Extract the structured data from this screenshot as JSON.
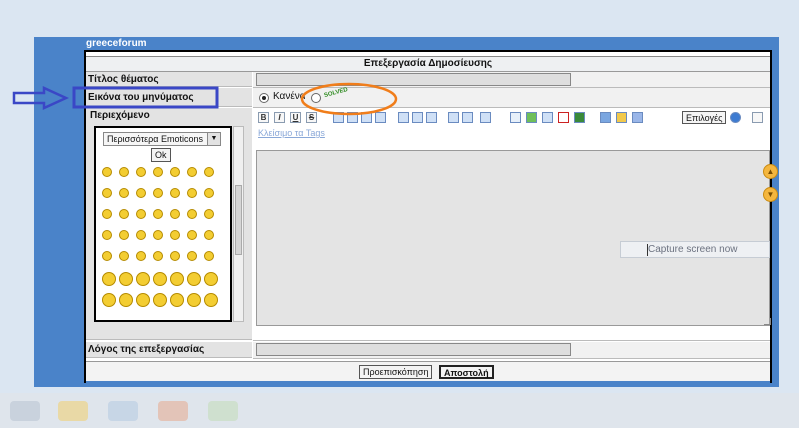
{
  "forum": {
    "title": "greeceforum"
  },
  "panel": {
    "heading": "Επεξεργασία Δημοσίευσης"
  },
  "labels": {
    "topic_title": "Τίτλος θέματος",
    "message_icon": "Εικόνα του μηνύματος",
    "content": "Περιεχόμενο",
    "edit_reason": "Λόγος της επεξεργασίας"
  },
  "icon_option": {
    "none_label": "Κανένα",
    "badge_text": "SOLVED"
  },
  "emoticons": {
    "dropdown_value": "Περισσότερα Emoticons",
    "ok_label": "Ok",
    "count": 49
  },
  "toolbar": {
    "bold": "B",
    "italic": "I",
    "underline": "U",
    "strike": "S",
    "options_label": "Επιλογές",
    "tag_link": "Κλείσιμο τα Tags"
  },
  "capture": {
    "label": "Capture screen now"
  },
  "buttons": {
    "preview": "Προεπισκόπηση",
    "submit": "Αποστολή"
  },
  "colors": {
    "frame": "#4a83c9",
    "highlight_box": "#3a47c6",
    "arrow": "#3a47c6",
    "annotation_oval": "#f07d1a",
    "emoticon": "#f3cd32",
    "orb": "#f4b63e"
  }
}
